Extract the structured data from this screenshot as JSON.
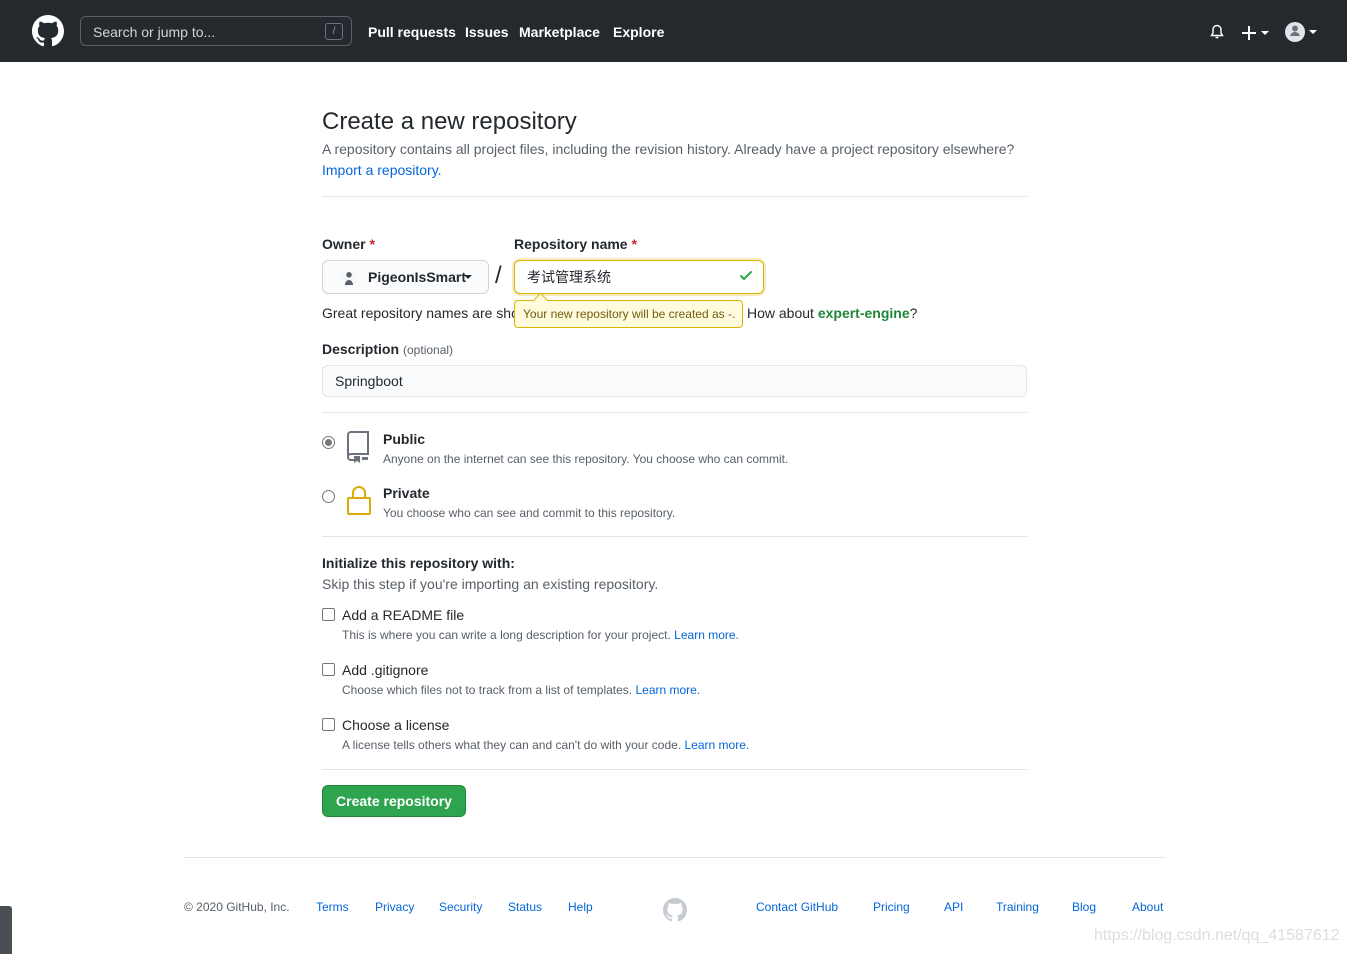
{
  "header": {
    "search_placeholder": "Search or jump to...",
    "search_key": "/",
    "nav": [
      "Pull requests",
      "Issues",
      "Marketplace",
      "Explore"
    ],
    "icons": [
      "github-logo",
      "bell-icon",
      "plus-icon",
      "avatar"
    ]
  },
  "page": {
    "title": "Create a new repository",
    "lead": "A repository contains all project files, including the revision history. Already have a project repository elsewhere?",
    "import_link": "Import a repository."
  },
  "form": {
    "owner_label": "Owner",
    "owner_value": "PigeonIsSmart",
    "name_label": "Repository name",
    "name_value": "考试管理系统",
    "required_mark": "*",
    "separator": "/",
    "hint": "Great repository names are short and memorable.",
    "tooltip": "Your new repository will be created as -.",
    "how_about_prefix": "How about ",
    "how_about_name": "expert-engine",
    "how_about_suffix": "?",
    "description_label": "Description",
    "description_optional": "(optional)",
    "description_value": "Springboot"
  },
  "visibility": {
    "options": [
      {
        "title": "Public",
        "note": "Anyone on the internet can see this repository. You choose who can commit.",
        "selected": true
      },
      {
        "title": "Private",
        "note": "You choose who can see and commit to this repository.",
        "selected": false
      }
    ]
  },
  "init": {
    "title": "Initialize this repository with:",
    "note": "Skip this step if you're importing an existing repository.",
    "options": [
      {
        "title": "Add a README file",
        "note": "This is where you can write a long description for your project.",
        "link": "Learn more."
      },
      {
        "title": "Add .gitignore",
        "note": "Choose which files not to track from a list of templates.",
        "link": "Learn more."
      },
      {
        "title": "Choose a license",
        "note": "A license tells others what they can and can't do with your code.",
        "link": "Learn more."
      }
    ]
  },
  "create_label": "Create repository",
  "footer": {
    "copyright": "© 2020 GitHub, Inc.",
    "left_links": [
      "Terms",
      "Privacy",
      "Security",
      "Status",
      "Help"
    ],
    "right_links": [
      "Contact GitHub",
      "Pricing",
      "API",
      "Training",
      "Blog",
      "About"
    ]
  },
  "watermark": "https://blog.csdn.net/qq_41587612",
  "colors": {
    "header_bg": "#24292e",
    "link": "#0366d6",
    "primary": "#2ea44f",
    "warn_border": "#d9b400",
    "success": "#28a745"
  }
}
